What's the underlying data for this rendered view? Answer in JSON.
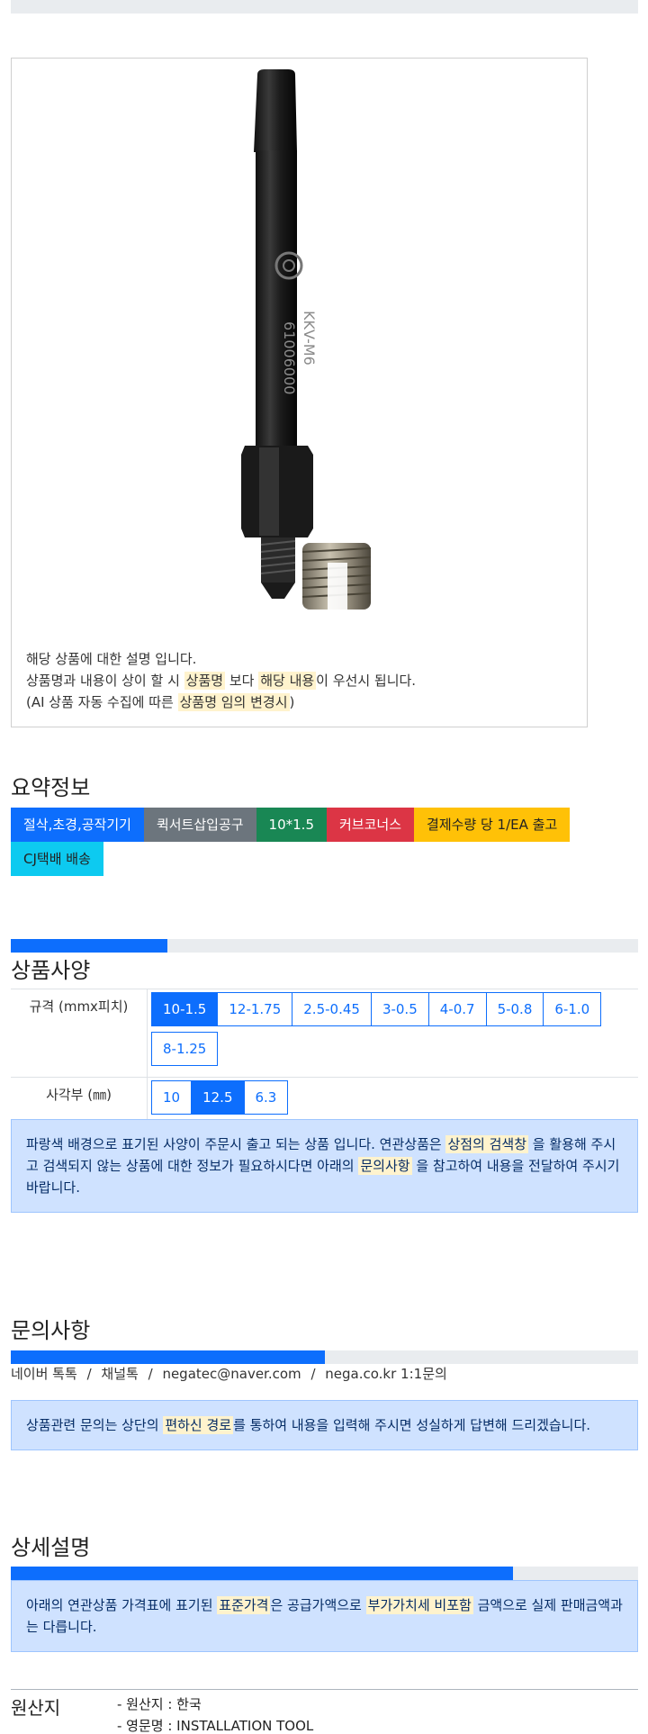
{
  "description": {
    "line1": "해당 상품에 대한 설명 입니다.",
    "line2_pre": "상품명과 내용이 상이 할 시 ",
    "line2_hl1": "상품명",
    "line2_mid": " 보다 ",
    "line2_hl2": "해당 내용",
    "line2_post": "이 우선시 됩니다.",
    "line3_pre": "(AI 상품 자동 수집에 따른 ",
    "line3_hl": "상품명 임의 변경시",
    "line3_post": ")"
  },
  "product_image": {
    "engraving1": "KKV-M6",
    "engraving2": "61006000"
  },
  "summary": {
    "title": "요약정보",
    "tags": [
      {
        "label": "절삭,초경,공작기기",
        "color": "#0d6efd"
      },
      {
        "label": "퀵서트삽입공구",
        "color": "#6c757d"
      },
      {
        "label": "10*1.5",
        "color": "#198754"
      },
      {
        "label": "커브코너스",
        "color": "#dc3545"
      },
      {
        "label": "결제수량 당 1/EA 출고",
        "color": "#ffc107"
      },
      {
        "label": "CJ택배 배송",
        "color": "#0dcaf0"
      }
    ]
  },
  "spec": {
    "title": "상품사양",
    "progress": 0.25,
    "rows": [
      {
        "label": "규격 (mmx피치)",
        "options": [
          "10-1.5",
          "12-1.75",
          "2.5-0.45",
          "3-0.5",
          "4-0.7",
          "5-0.8",
          "6-1.0",
          "8-1.25"
        ],
        "selected": "10-1.5"
      },
      {
        "label": "사각부 (㎜)",
        "options": [
          "10",
          "12.5",
          "6.3"
        ],
        "selected": "12.5"
      }
    ],
    "notice_pre": "파랑색 배경으로 표기된 사양이 주문시 출고 되는 상품 입니다. 연관상품은 ",
    "notice_hl1": "상점의 검색창",
    "notice_mid": " 을 활용해 주시고 검색되지 않는 상품에 대한 정보가 필요하시다면 아래의 ",
    "notice_hl2": "문의사항",
    "notice_post": " 을 참고하여 내용을 전달하여 주시기 바랍니다."
  },
  "inquiry": {
    "title": "문의사항",
    "progress": 0.5,
    "contacts": [
      "네이버 톡톡",
      "채널톡",
      "negatec@naver.com",
      "nega.co.kr 1:1문의"
    ],
    "separator": "/",
    "notice_pre": "상품관련 문의는 상단의 ",
    "notice_hl": "편하신 경로",
    "notice_post": "를 통하여 내용을 입력해 주시면 성실하게 답변해 드리겠습니다."
  },
  "detail": {
    "title": "상세설명",
    "progress": 0.8,
    "notice_pre": "아래의 연관상품 가격표에 표기된 ",
    "notice_hl1": "표준가격",
    "notice_mid": "은 공급가액으로 ",
    "notice_hl2": "부가가치세 비포함",
    "notice_post": " 금액으로 실제 판매금액과는 다릅니다."
  },
  "origin": {
    "title": "원산지",
    "items": [
      "- 원산지 : 한국",
      "- 영문명 : INSTALLATION TOOL"
    ]
  }
}
